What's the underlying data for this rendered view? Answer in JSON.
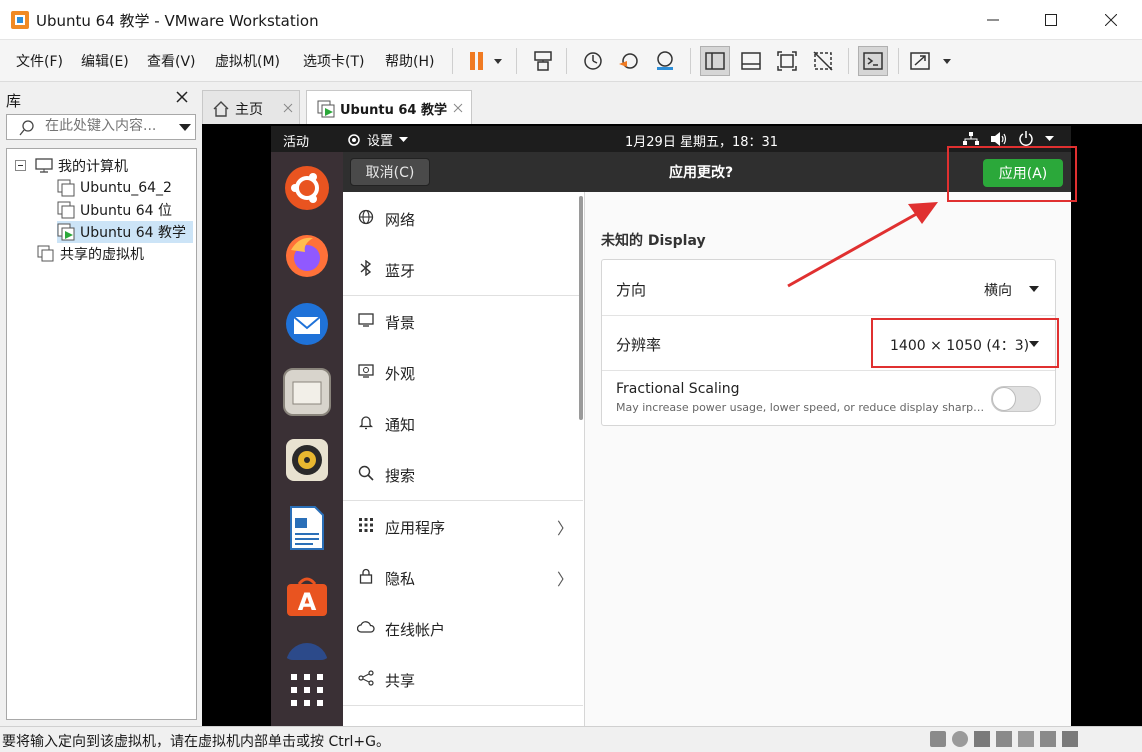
{
  "window": {
    "title": "Ubuntu 64 教学 - VMware Workstation"
  },
  "menu": [
    "文件(F)",
    "编辑(E)",
    "查看(V)",
    "虚拟机(M)",
    "选项卡(T)",
    "帮助(H)"
  ],
  "library": {
    "title": "库",
    "search_placeholder": "在此处键入内容...",
    "tree": {
      "root": "我的计算机",
      "vms": [
        "Ubuntu_64_2",
        "Ubuntu 64 位",
        "Ubuntu 64 教学"
      ],
      "shared": "共享的虚拟机"
    }
  },
  "tabs": [
    {
      "label": "主页"
    },
    {
      "label": "Ubuntu 64 教学"
    }
  ],
  "ubuntu": {
    "activities": "活动",
    "settings_menu": "设置",
    "clock": "1月29日 星期五，18：31"
  },
  "dialog": {
    "cancel": "取消(C)",
    "title": "应用更改?",
    "apply": "应用(A)"
  },
  "sidebar": {
    "items": [
      {
        "label": "网络",
        "icon": "network-icon"
      },
      {
        "label": "蓝牙",
        "icon": "bluetooth-icon"
      },
      {
        "label": "背景",
        "icon": "background-icon"
      },
      {
        "label": "外观",
        "icon": "appearance-icon"
      },
      {
        "label": "通知",
        "icon": "bell-icon"
      },
      {
        "label": "搜索",
        "icon": "search-icon"
      },
      {
        "label": "应用程序",
        "icon": "apps-icon"
      },
      {
        "label": "隐私",
        "icon": "lock-icon"
      },
      {
        "label": "在线帐户",
        "icon": "cloud-icon"
      },
      {
        "label": "共享",
        "icon": "share-icon"
      }
    ]
  },
  "display": {
    "section_title": "未知的 Display",
    "orientation_label": "方向",
    "orientation_value": "横向",
    "resolution_label": "分辨率",
    "resolution_value": "1400 × 1050 (4：3)",
    "fractional_label": "Fractional Scaling",
    "fractional_desc": "May increase power usage, lower speed, or reduce display sharp…",
    "fractional_enabled": false
  },
  "statusbar": {
    "text": "要将输入定向到该虚拟机，请在虚拟机内部单击或按 Ctrl+G。"
  },
  "colors": {
    "accent_green": "#2ba83a",
    "highlight_red": "#e03030",
    "pause_orange": "#f07a22"
  }
}
